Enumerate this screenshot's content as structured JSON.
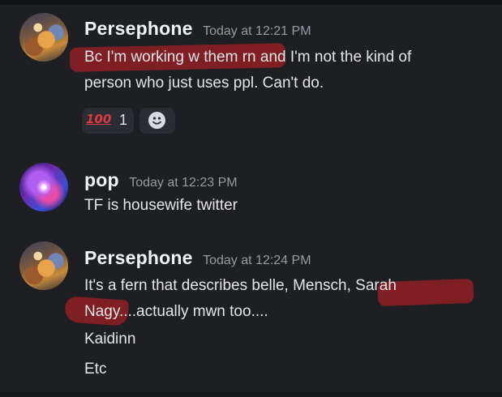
{
  "messages": [
    {
      "username": "Persephone",
      "timestamp": "Today at 12:21 PM",
      "lines": [
        {
          "highlighted": "Bc I'm working w them rn",
          "rest": " and I'm not the kind of"
        },
        {
          "text": "person who just uses ppl. Can't do."
        }
      ],
      "reaction": {
        "emoji": "💯",
        "emoji_text": "100",
        "count": "1",
        "add_icon": "smile-plus-icon"
      },
      "avatar": "fantasy-artwork-avatar"
    },
    {
      "username": "pop",
      "timestamp": "Today at 12:23 PM",
      "lines": [
        {
          "text": "TF is housewife twitter"
        }
      ],
      "avatar": "galaxy-swirl-avatar"
    },
    {
      "username": "Persephone",
      "timestamp": "Today at 12:24 PM",
      "lines": [
        {
          "text": "It's a fern that describes belle, Mensch, Sarah"
        },
        {
          "text": "Nagy....actually mwn too...."
        },
        {
          "text": "Kaidinn"
        },
        {
          "text": "Etc"
        }
      ],
      "avatar": "fantasy-artwork-avatar"
    }
  ],
  "colors": {
    "background": "#1e1f23",
    "highlight": "#9c2024",
    "username": "#f2f3f5",
    "timestamp": "#969aa1",
    "text": "#e3e5e8",
    "reaction_bg": "#2b2d34"
  }
}
